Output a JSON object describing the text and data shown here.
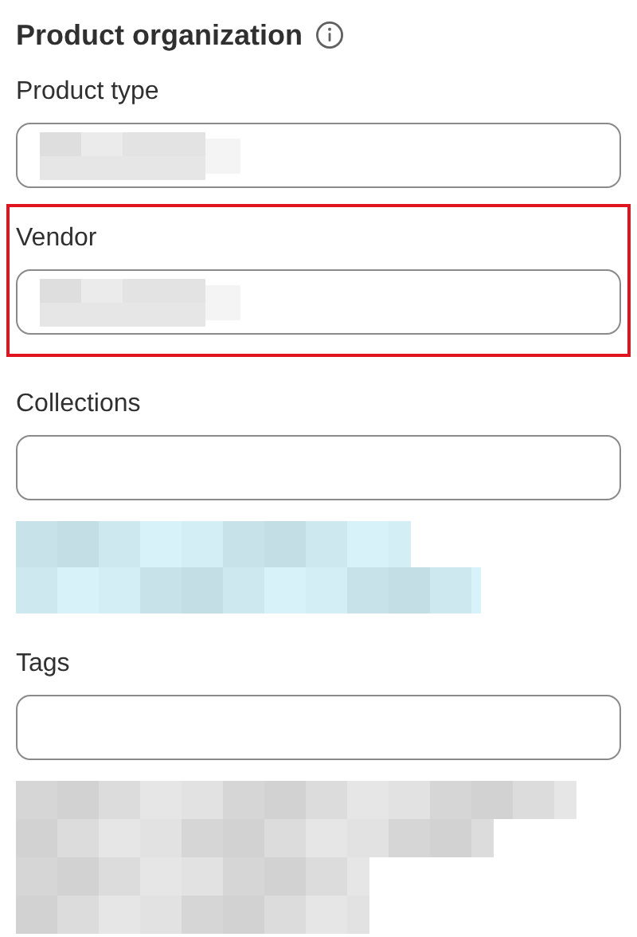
{
  "title": "Product organization",
  "fields": [
    {
      "label": "Product type",
      "highlighted": false,
      "value_blurred": true
    },
    {
      "label": "Vendor",
      "highlighted": true,
      "value_blurred": true
    },
    {
      "label": "Collections",
      "highlighted": false,
      "value_blurred": false,
      "blurred_list": {
        "color": "#c8e2ea"
      }
    },
    {
      "label": "Tags",
      "highlighted": false,
      "value_blurred": false,
      "blurred_list": {
        "color": "#d6d6d6"
      }
    }
  ]
}
